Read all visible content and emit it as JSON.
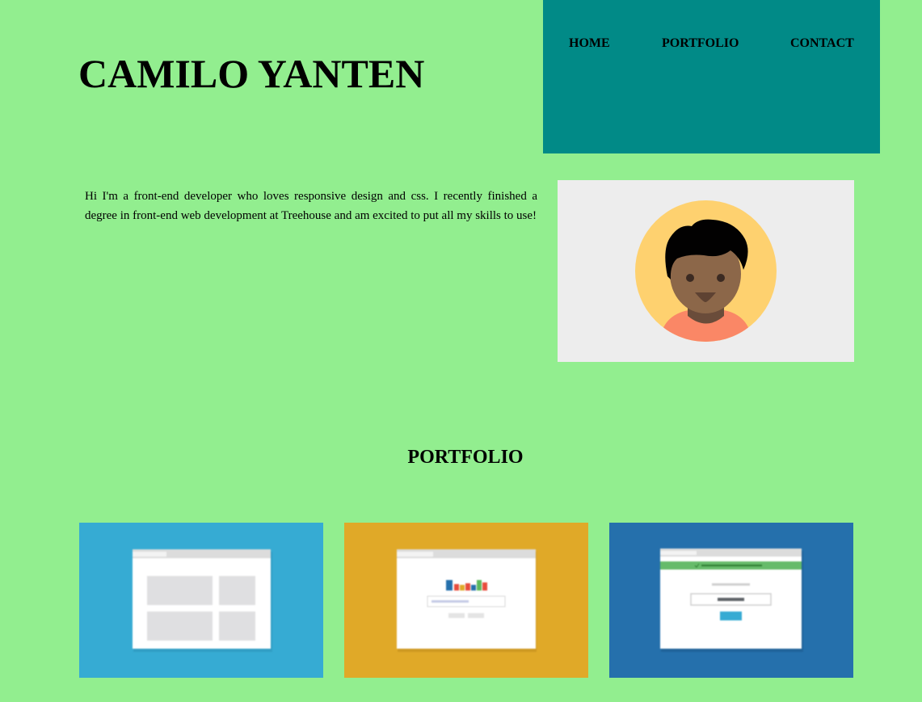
{
  "header": {
    "site_title": "CAMILO YANTEN"
  },
  "nav": {
    "items": [
      {
        "label": "HOME"
      },
      {
        "label": "PORTFOLIO"
      },
      {
        "label": "CONTACT"
      }
    ]
  },
  "about": {
    "intro": "Hi I'm a front-end developer who loves responsive design and css. I recently finished a degree in front-end web development at Treehouse and am excited to put all my skills to use!"
  },
  "portfolio": {
    "heading": "PORTFOLIO",
    "projects": [
      {
        "bg": "#36abd3",
        "icon": "grid-layout-icon"
      },
      {
        "bg": "#e0a928",
        "icon": "bar-chart-form-icon"
      },
      {
        "bg": "#2570ac",
        "icon": "login-form-icon"
      }
    ]
  },
  "colors": {
    "page_bg": "#92ee8f",
    "nav_bg": "#018a87",
    "avatar_panel_bg": "#ededed"
  }
}
